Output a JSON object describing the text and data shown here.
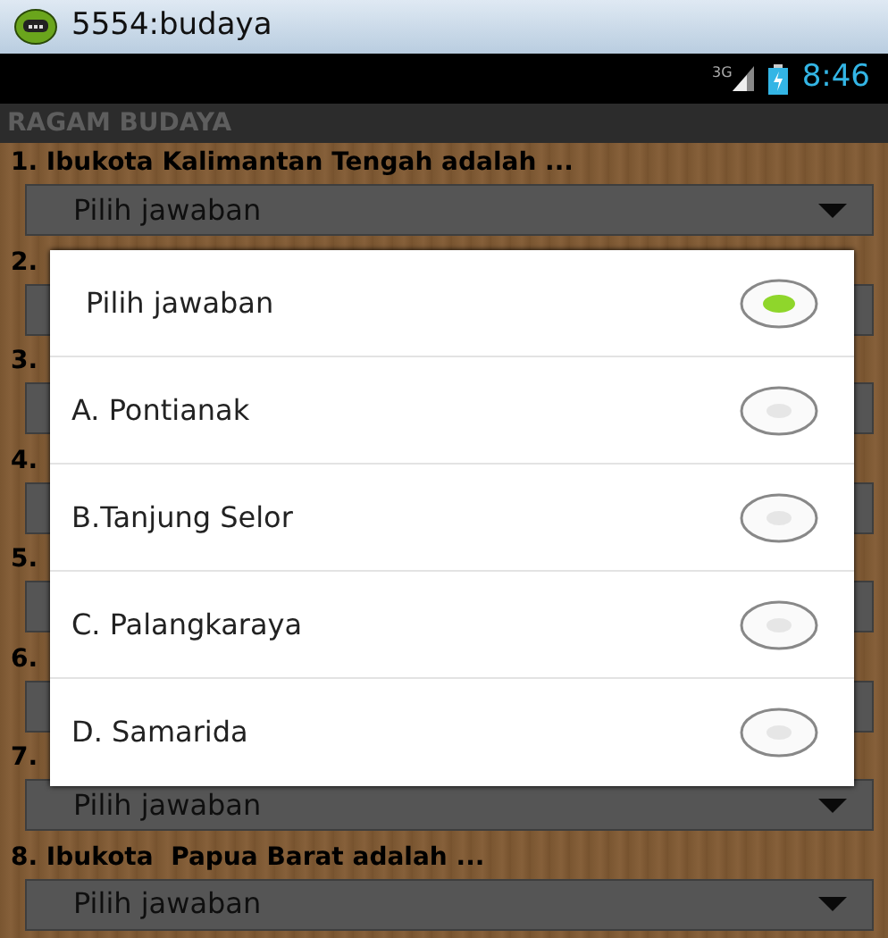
{
  "window": {
    "title": "5554:budaya"
  },
  "status_bar": {
    "network": "3G",
    "time": "8:46"
  },
  "app_bar": {
    "title": "RAGAM BUDAYA"
  },
  "questions": [
    {
      "label": "1. Ibukota Kalimantan Tengah adalah ...",
      "answer": "Pilih jawaban"
    },
    {
      "label": "2."
    },
    {
      "label": "3."
    },
    {
      "label": "4."
    },
    {
      "label": "5."
    },
    {
      "label": "6."
    },
    {
      "label": "7.",
      "answer": "Pilih jawaban"
    },
    {
      "label": "8. Ibukota  Papua Barat adalah ...",
      "answer": "Pilih jawaban"
    }
  ],
  "dialog": {
    "options": [
      {
        "label": "Pilih jawaban",
        "selected": true
      },
      {
        "label": "A. Pontianak",
        "selected": false
      },
      {
        "label": "B.Tanjung Selor",
        "selected": false
      },
      {
        "label": "C. Palangkaraya",
        "selected": false
      },
      {
        "label": "D. Samarida",
        "selected": false
      }
    ]
  }
}
